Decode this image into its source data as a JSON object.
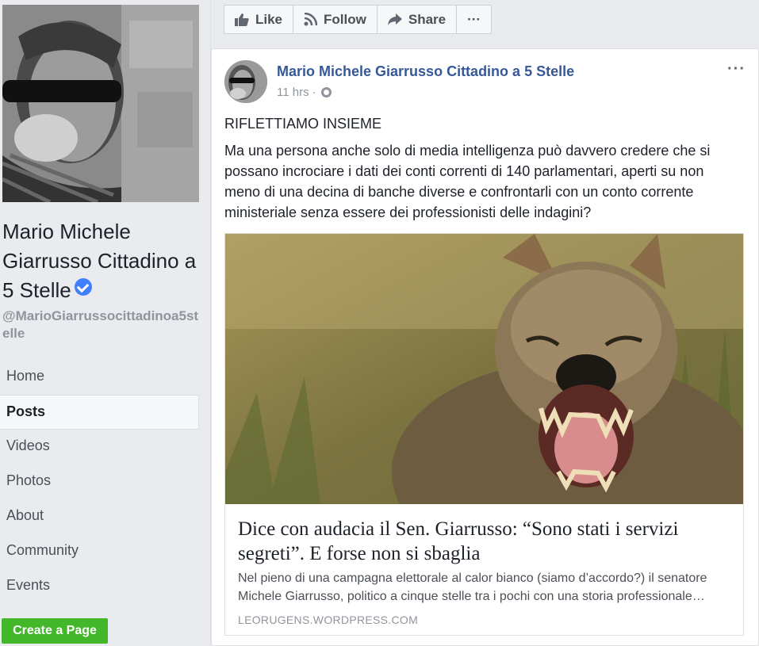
{
  "sidebar": {
    "page_name": "Mario Michele Giarrusso Cittadino a 5 Stelle",
    "handle": "@MarioGiarrussocittadinoa5stelle",
    "nav": [
      "Home",
      "Posts",
      "Videos",
      "Photos",
      "About",
      "Community",
      "Events"
    ],
    "active_nav": "Posts",
    "create_page": "Create a Page"
  },
  "action_bar": {
    "like": "Like",
    "follow": "Follow",
    "share": "Share",
    "more": "···"
  },
  "post": {
    "author": "Mario Michele Giarrusso Cittadino a 5 Stelle",
    "time": "11 hrs",
    "separator": "·",
    "menu": "···",
    "headline": "RIFLETTIAMO INSIEME",
    "body": "Ma una persona anche solo di media intelligenza può davvero credere che si possano incrociare i dati dei conti correnti di 140 parlamentari, aperti su non meno di una decina di banche diverse e confrontarli con un conto corrente ministeriale senza essere dei professionisti delle indagini?",
    "link": {
      "title": "Dice con audacia il Sen. Giarrusso: “Sono stati i servizi segreti”. E forse non si sbaglia",
      "desc_line1": "Nel pieno di una campagna elettorale al calor bianco (siamo d’accordo?) il senatore",
      "desc_line2": "Michele Giarrusso, politico a cinque stelle tra i pochi con una storia professionale…",
      "domain": "LEORUGENS.WORDPRESS.COM"
    }
  },
  "colors": {
    "link_blue": "#365899",
    "create_green": "#42b72a",
    "verified_blue": "#4080ff"
  }
}
